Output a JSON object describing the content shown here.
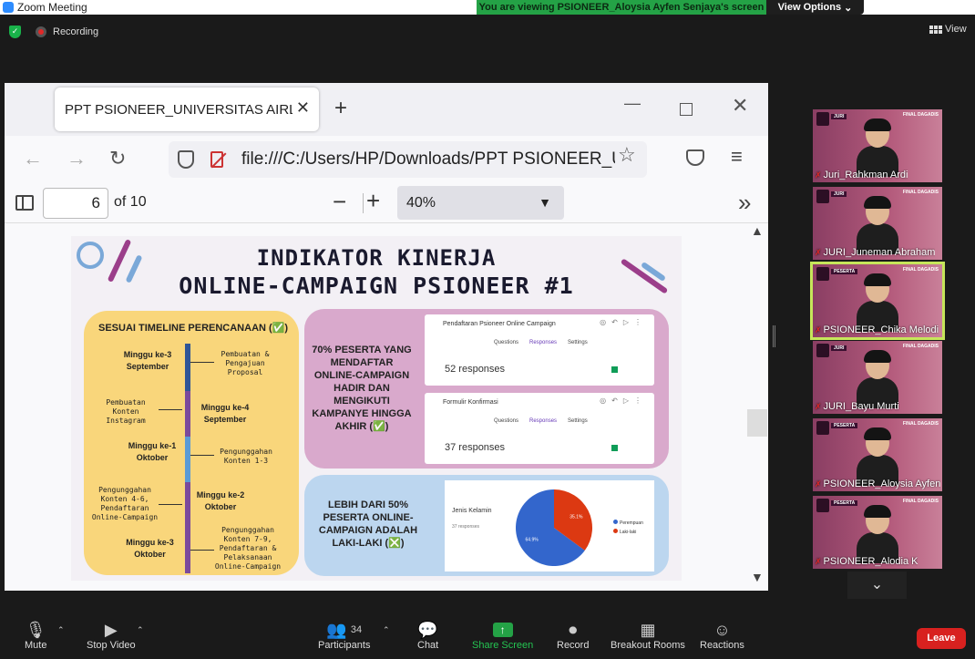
{
  "window": {
    "title": "Zoom Meeting"
  },
  "share_banner": {
    "text": "You are viewing PSIONEER_Aloysia Ayfen Senjaya's screen",
    "options_label": "View Options"
  },
  "status": {
    "recording_label": "Recording",
    "view_label": "View"
  },
  "browser": {
    "tab_title": "PPT PSIONEER_UNIVERSITAS AIRLANGGA",
    "url": "file:///C:/Users/HP/Downloads/PPT PSIONEER_UNIVERSITAS AIRLANGGA",
    "page_number": "6",
    "page_total": "of 10",
    "zoom": "40%"
  },
  "slide": {
    "title_line1": "INDIKATOR KINERJA",
    "title_line2": "ONLINE-CAMPAIGN PSIONEER #1",
    "left_heading": "SESUAI TIMELINE PERENCANAAN (✅)",
    "timeline": [
      {
        "week": "Minggu ke-3\nSeptember",
        "task": "Pembuatan &\nPengajuan\nProposal"
      },
      {
        "week": "Minggu ke-4\nSeptember",
        "task": "Pembuatan\nKonten\nInstagram"
      },
      {
        "week": "Minggu ke-1\nOktober",
        "task": "Pengunggahan\nKonten 1-3"
      },
      {
        "week": "Minggu ke-2\nOktober",
        "task": "Pengunggahan\nKonten 4-6,\nPendaftaran\nOnline-Campaign"
      },
      {
        "week": "Minggu ke-3\nOktober",
        "task": "Pengunggahan\nKonten 7-9,\nPendaftaran &\nPelaksanaan\nOnline-Campaign"
      }
    ],
    "top_text": "70% PESERTA YANG MENDAFTAR ONLINE-CAMPAIGN HADIR DAN MENGIKUTI KAMPANYE HINGGA AKHIR (✅)",
    "form1": {
      "name": "Pendaftaran Psioneer Online Campaign",
      "tabs": [
        "Questions",
        "Responses",
        "Settings"
      ],
      "responses": "52 responses"
    },
    "form2": {
      "name": "Formulir Konfirmasi",
      "tabs": [
        "Questions",
        "Responses",
        "Settings"
      ],
      "responses": "37 responses"
    },
    "bottom_text": "LEBIH DARI 50% PESERTA ONLINE-CAMPAIGN ADALAH LAKI-LAKI (❎)",
    "pie": {
      "title": "Jenis Kelamin",
      "subtitle": "37 responses",
      "legend": [
        "Perempuan",
        "Laki-laki"
      ],
      "labels": [
        "64.9%",
        "35.1%"
      ],
      "colors": [
        "#3366cc",
        "#dc3912"
      ]
    }
  },
  "chart_data": {
    "type": "pie",
    "title": "Jenis Kelamin",
    "categories": [
      "Perempuan",
      "Laki-laki"
    ],
    "values": [
      64.9,
      35.1
    ]
  },
  "participants_gallery": [
    {
      "name": "Juri_Rahkman Ardi",
      "role": "JURI",
      "active": false
    },
    {
      "name": "JURI_Juneman Abraham",
      "role": "JURI",
      "active": false
    },
    {
      "name": "PSIONEER_Chika Melodi",
      "role": "PESERTA",
      "active": true
    },
    {
      "name": "JURI_Bayu Murti",
      "role": "JURI",
      "active": false
    },
    {
      "name": "PSIONEER_Aloysia Ayfen",
      "role": "PESERTA",
      "active": false
    },
    {
      "name": "PSIONEER_Alodia K",
      "role": "PESERTA",
      "active": false
    }
  ],
  "gallery_final_label": "FINAL DAGADIS",
  "toolbar": {
    "mute": "Mute",
    "stop_video": "Stop Video",
    "participants": "Participants",
    "participant_count": "34",
    "chat": "Chat",
    "share_screen": "Share Screen",
    "record": "Record",
    "breakout": "Breakout Rooms",
    "reactions": "Reactions",
    "leave": "Leave"
  }
}
